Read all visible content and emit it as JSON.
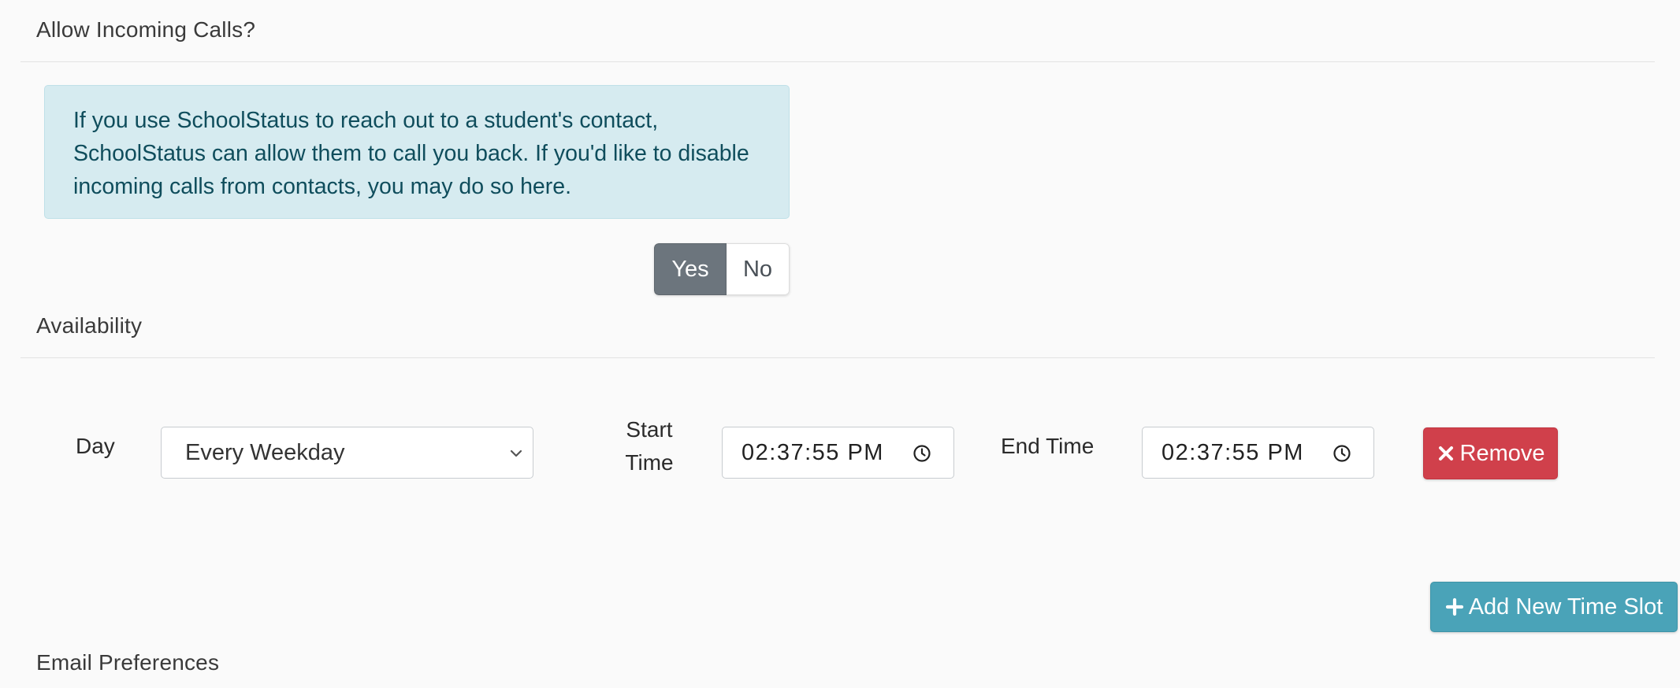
{
  "incoming_calls": {
    "heading": "Allow Incoming Calls?",
    "info_text": "If you use SchoolStatus to reach out to a student's contact, SchoolStatus can allow them to call you back. If you'd like to disable incoming calls from contacts, you may do so here.",
    "toggle": {
      "yes_label": "Yes",
      "no_label": "No",
      "selected": "Yes"
    }
  },
  "availability": {
    "heading": "Availability",
    "slot": {
      "day_label": "Day",
      "day_value": "Every Weekday",
      "start_label_line1": "Start",
      "start_label_line2": "Time",
      "start_value": "02:37:55 PM",
      "end_label": "End Time",
      "end_value": "02:37:55 PM",
      "remove_label": "Remove"
    },
    "add_label": "Add New Time Slot"
  },
  "email_preferences": {
    "heading": "Email Preferences"
  },
  "icons": {
    "remove": "close-icon",
    "add": "plus-icon",
    "time": "clock-icon",
    "select": "chevron-down-icon"
  },
  "colors": {
    "info_bg": "#d6ebf0",
    "info_text": "#0f4d5c",
    "toggle_selected": "#6c757d",
    "danger": "#d0404b",
    "accent": "#4aa3b8"
  }
}
